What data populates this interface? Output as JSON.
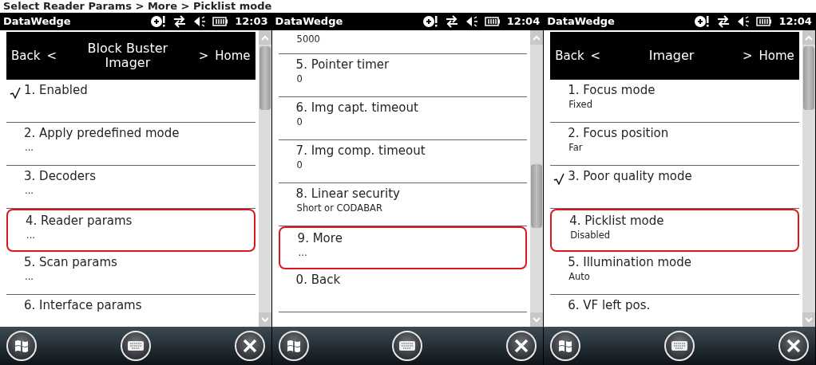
{
  "caption": "Select Reader Params > More > Picklist mode",
  "screens": [
    {
      "status": {
        "app": "DataWedge",
        "time": "12:03"
      },
      "header": {
        "back": "Back",
        "back_arrow": "<",
        "title": "Block Buster Imager",
        "forward_arrow": ">",
        "home": "Home"
      },
      "items": [
        {
          "label": "1. Enabled",
          "checked": true,
          "highlighted": false
        },
        {
          "label": "2. Apply predefined mode",
          "value": "...",
          "checked": false,
          "highlighted": false
        },
        {
          "label": "3. Decoders",
          "value": "...",
          "checked": false,
          "highlighted": false
        },
        {
          "label": "4. Reader params",
          "value": "...",
          "checked": false,
          "highlighted": true
        },
        {
          "label": "5. Scan params",
          "value": "...",
          "checked": false,
          "highlighted": false
        },
        {
          "label": "6. Interface params",
          "checked": false,
          "highlighted": false
        }
      ]
    },
    {
      "status": {
        "app": "DataWedge",
        "time": "12:04"
      },
      "items": [
        {
          "value": "5000",
          "checked": false,
          "highlighted": false
        },
        {
          "label": "5. Pointer timer",
          "value": "0",
          "checked": false,
          "highlighted": false
        },
        {
          "label": "6. Img capt. timeout",
          "value": "0",
          "checked": false,
          "highlighted": false
        },
        {
          "label": "7. Img comp. timeout",
          "value": "0",
          "checked": false,
          "highlighted": false
        },
        {
          "label": "8. Linear security",
          "value": "Short or CODABAR",
          "checked": false,
          "highlighted": false
        },
        {
          "label": "9. More",
          "value": "...",
          "checked": false,
          "highlighted": true
        },
        {
          "label": "0. Back",
          "checked": false,
          "highlighted": false
        }
      ]
    },
    {
      "status": {
        "app": "DataWedge",
        "time": "12:04"
      },
      "header": {
        "back": "Back",
        "back_arrow": "<",
        "title": "Imager",
        "forward_arrow": ">",
        "home": "Home"
      },
      "items": [
        {
          "label": "1. Focus mode",
          "value": "Fixed",
          "checked": false,
          "highlighted": false
        },
        {
          "label": "2. Focus position",
          "value": "Far",
          "checked": false,
          "highlighted": false
        },
        {
          "label": "3. Poor quality mode",
          "checked": true,
          "highlighted": false
        },
        {
          "label": "4. Picklist mode",
          "value": "Disabled",
          "checked": false,
          "highlighted": true
        },
        {
          "label": "5. Illumination mode",
          "value": "Auto",
          "checked": false,
          "highlighted": false
        },
        {
          "label": "6. VF left pos.",
          "checked": false,
          "highlighted": false
        }
      ]
    }
  ]
}
